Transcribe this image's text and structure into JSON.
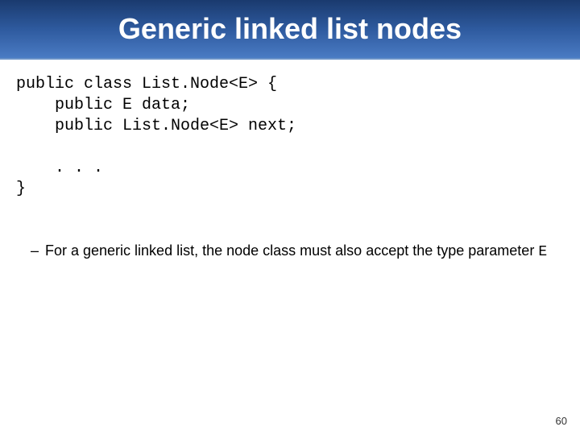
{
  "title": "Generic linked list nodes",
  "code": {
    "line1": "public class List.Node<E> {",
    "line2": "    public E data;",
    "line3": "    public List.Node<E> next;",
    "line4": "",
    "line5": "    . . .",
    "line6": "}"
  },
  "bullet": {
    "dash": "–",
    "text_before": "For a generic linked list, the node class must also accept the type parameter ",
    "mono": "E"
  },
  "page_number": "60"
}
